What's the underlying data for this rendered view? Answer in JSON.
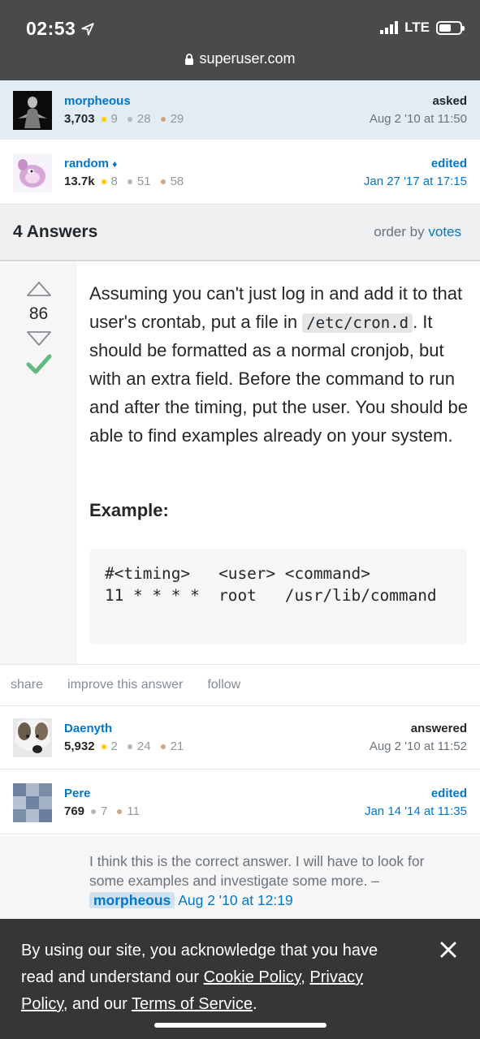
{
  "status_bar": {
    "time": "02:53",
    "network": "LTE"
  },
  "browser": {
    "url": "superuser.com"
  },
  "question_owner": {
    "name": "morpheous",
    "reputation": "3,703",
    "gold": "9",
    "silver": "28",
    "bronze": "29",
    "action": "asked",
    "date": "Aug 2 '10 at 11:50"
  },
  "question_editor": {
    "name": "random",
    "diamond": "♦",
    "reputation": "13.7k",
    "gold": "8",
    "silver": "51",
    "bronze": "58",
    "action": "edited",
    "date": "Jan 27 '17 at 17:15"
  },
  "answers_header": {
    "count": "4 Answers",
    "order_label": "order by",
    "order_value": "votes"
  },
  "answer": {
    "votes": "86",
    "text_part1": "Assuming you can't just log in and add it to that user's crontab, put a file in ",
    "inline_code": "/etc/cron.d",
    "text_part2": ". It should be formatted as a normal cronjob, but with an extra field. Before the command to run and after the timing, put the user. You should be able to find examples already on your system.",
    "example_heading": "Example:",
    "code_block": "#<timing>   <user> <command>\n11 * * * *  root   /usr/lib/command"
  },
  "post_menu": {
    "share": "share",
    "improve": "improve this answer",
    "follow": "follow"
  },
  "answer_author": {
    "name": "Daenyth",
    "reputation": "5,932",
    "gold": "2",
    "silver": "24",
    "bronze": "21",
    "action": "answered",
    "date": "Aug 2 '10 at 11:52"
  },
  "answer_editor": {
    "name": "Pere",
    "reputation": "769",
    "silver": "7",
    "bronze": "11",
    "action": "edited",
    "date": "Jan 14 '14 at 11:35"
  },
  "comment": {
    "text": "I think this is the correct answer. I will have to look for some examples and investigate some more. –",
    "user": "morpheous",
    "date": "Aug 2 '10 at 12:19"
  },
  "cookie_banner": {
    "text1": "By using our site, you acknowledge that you have read and understand our ",
    "cookie_policy": "Cookie Policy",
    "sep1": ", ",
    "privacy_policy": "Privacy Policy",
    "text2": ", and our ",
    "terms": "Terms of Service",
    "text3": "."
  },
  "colors": {
    "link": "#0077cc",
    "accepted": "#5eba7d",
    "highlight": "#e1ecf4",
    "banner": "#353638"
  },
  "icons": [
    "location-arrow-icon",
    "signal-icon",
    "battery-icon",
    "lock-icon",
    "upvote-icon",
    "downvote-icon",
    "accepted-check-icon",
    "close-icon"
  ]
}
